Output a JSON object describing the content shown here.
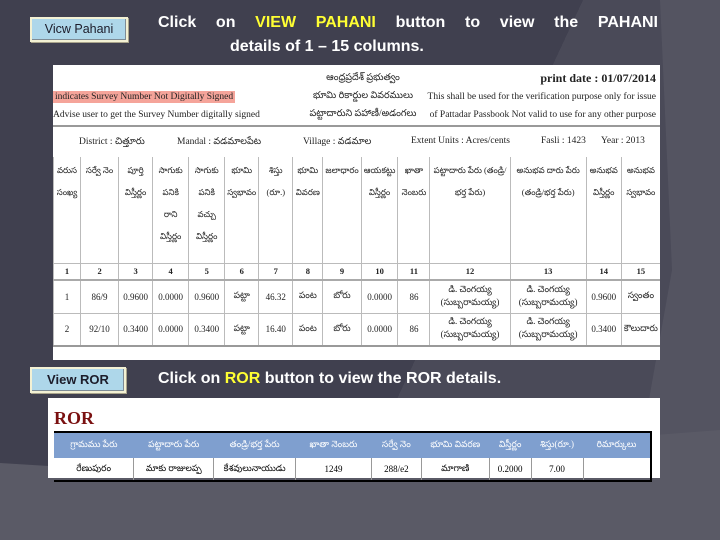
{
  "instructions": {
    "pahani_button": "Vicw Pahani",
    "pahani_text_before": "Click on ",
    "pahani_highlight": "VIEW PAHANI",
    "pahani_text_after": " button to view the PAHANI",
    "pahani_text_line2": "details of 1 – 15 columns.",
    "ror_button": "View ROR",
    "ror_text_before": "Click on ",
    "ror_highlight": "ROR",
    "ror_text_after": " button to view the ROR details."
  },
  "colors": {
    "background": "#40404f",
    "highlight": "#ffff33",
    "button_bg": "#aed7ea",
    "banner_bg": "#f5a49a",
    "ror_header_bg": "#7f9fcf",
    "ror_title": "#7a1010"
  },
  "pahani": {
    "banner": "indicates Survey Number Not Digitally Signed",
    "advise": "Advise user to get the Survey Number digitally signed",
    "gov_lines": [
      "ఆంధ్రప్రదేశ్ ప్రభుత్వం",
      "భూమి రికార్డుల వివరములు",
      "పట్టాదారుని పహాణీ/అడంగలు"
    ],
    "print_date": "print date : 01/07/2014",
    "note1": "This shall be used for the verification purpose only for issue",
    "note2": "of Pattadar Passbook Not valid to use for any other purpose",
    "meta": {
      "district": "District : చిత్తూరు",
      "mandal": "Mandal : వడమాలపేట",
      "village": "Village : వడమాల",
      "extent_units": "Extent Units : Acres/cents",
      "fasli": "Fasli : 1423",
      "year": "Year : 2013"
    },
    "headers": [
      "వరుస సంఖ్య",
      "సర్వే నెం",
      "పూర్తి విస్తీర్ణం",
      "సాగుకు పనికి రాని విస్తీర్ణం",
      "సాగుకు పనికి వచ్చు విస్తీర్ణం",
      "భూమి స్వభావం",
      "శిస్తు (రూ.)",
      "భూమి వివరణ",
      "జలాధారం",
      "ఆయకట్టు విస్తీర్ణం",
      "ఖాతా నెంబరు",
      "పట్టాదారు పేరు (తండ్రి/భర్త పేరు)",
      "అనుభవ దారు పేరు (తండ్రి/భర్త పేరు)",
      "అనుభవ విస్తీర్ణం",
      "అనుభవ స్వభావం"
    ],
    "column_numbers": [
      "1",
      "2",
      "3",
      "4",
      "5",
      "6",
      "7",
      "8",
      "9",
      "10",
      "11",
      "12",
      "13",
      "14",
      "15"
    ],
    "rows": [
      [
        "1",
        "86/9",
        "0.9600",
        "0.0000",
        "0.9600",
        "పట్టా",
        "46.32",
        "పంట",
        "బోరు",
        "0.0000",
        "86",
        "డి. చెంగయ్య (సుబ్బరామయ్య)",
        "డి. చెంగయ్య (సుబ్బరామయ్య)",
        "0.9600",
        "స్వంతం"
      ],
      [
        "2",
        "92/10",
        "0.3400",
        "0.0000",
        "0.3400",
        "పట్టా",
        "16.40",
        "పంట",
        "బోరు",
        "0.0000",
        "86",
        "డి. చెంగయ్య (సుబ్బరామయ్య)",
        "డి. చెంగయ్య (సుబ్బరామయ్య)",
        "0.3400",
        "కౌలుదారు"
      ]
    ]
  },
  "ror": {
    "title": "ROR",
    "headers": [
      "గ్రామము పేరు",
      "పట్టాదారు పేరు",
      "తండ్రి/భర్త పేరు",
      "ఖాతా నెంబరు",
      "సర్వే నెం",
      "భూమి వివరణ",
      "విస్తీర్ణం",
      "శిస్తు(రూ.)",
      "రిమార్కులు"
    ],
    "rows": [
      [
        "రేణుపురం",
        "మాకు రాజులప్ప",
        "కేశవులునాయుడు",
        "1249",
        "288/e2",
        "మాగాణి",
        "0.2000",
        "7.00",
        ""
      ]
    ]
  }
}
